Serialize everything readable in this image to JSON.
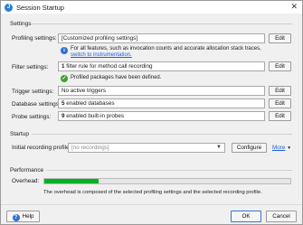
{
  "window": {
    "title": "Session Startup",
    "close_glyph": "✕"
  },
  "settings": {
    "heading": "Settings",
    "profiling": {
      "label": "Profiling settings:",
      "value": "[Customized profiling settings]",
      "edit": "Edit"
    },
    "profiling_note": {
      "text": "For all features, such as invocation counts and accurate allocation stack traces,",
      "link": "switch to instrumentation."
    },
    "filter": {
      "label": "Filter settings:",
      "count": "1",
      "text": "filter rule for method call recording",
      "edit": "Edit"
    },
    "filter_note": "Profiled packages have been defined.",
    "trigger": {
      "label": "Trigger settings:",
      "value": "No active triggers",
      "edit": "Edit"
    },
    "database": {
      "label": "Database settings:",
      "count": "5",
      "text": "enabled databases",
      "edit": "Edit"
    },
    "probe": {
      "label": "Probe settings:",
      "count": "9",
      "text": "enabled built-in probes",
      "edit": "Edit"
    }
  },
  "startup": {
    "heading": "Startup",
    "initial_label": "Initial recording profile:",
    "initial_value": "[no recordings]",
    "configure": "Configure",
    "more": "More"
  },
  "performance": {
    "heading": "Performance",
    "overhead_label": "Overhead:",
    "overhead_fraction": 0.22,
    "note": "The overhead is composed of the selected profiling settings and the selected recording profile."
  },
  "footer": {
    "help": "Help",
    "ok": "OK",
    "cancel": "Cancel"
  },
  "colors": {
    "progress": "#06b025",
    "link": "#1c5fd8",
    "info": "#2f6fd0",
    "ok": "#3fa12f"
  }
}
